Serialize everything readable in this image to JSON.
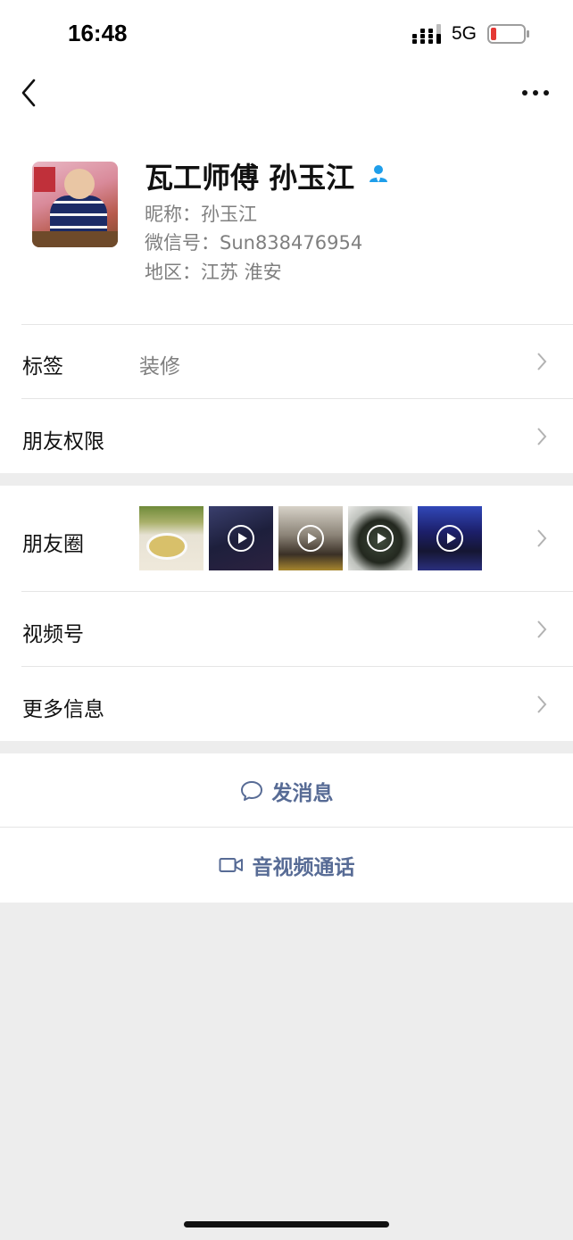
{
  "status_bar": {
    "time": "16:48",
    "network": "5G",
    "battery_color": "#e53935"
  },
  "nav": {
    "back_icon": "chevron-left-icon",
    "more_icon": "ellipsis-icon"
  },
  "profile": {
    "display_name": "瓦工师傅 孙玉江",
    "nickname_line": "昵称：孙玉江",
    "wechat_id_line": "微信号：Sun838476954",
    "region_line": "地区：江苏 淮安",
    "contact_icon": "contact-person-icon",
    "contact_icon_color": "#1f9eea"
  },
  "rows": {
    "tags": {
      "label": "标签",
      "value": "装修"
    },
    "permissions": {
      "label": "朋友权限"
    },
    "moments": {
      "label": "朋友圈"
    },
    "channels": {
      "label": "视频号"
    },
    "more_info": {
      "label": "更多信息"
    }
  },
  "moments_thumbs": [
    {
      "kind": "photo",
      "is_video": false
    },
    {
      "kind": "video",
      "is_video": true
    },
    {
      "kind": "video",
      "is_video": true
    },
    {
      "kind": "video",
      "is_video": true
    },
    {
      "kind": "video",
      "is_video": true
    }
  ],
  "actions": {
    "message": {
      "label": "发消息",
      "icon": "chat-bubble-icon"
    },
    "call": {
      "label": "音视频通话",
      "icon": "video-camera-icon"
    }
  },
  "colors": {
    "link_blue": "#576b95",
    "background": "#ededed"
  }
}
